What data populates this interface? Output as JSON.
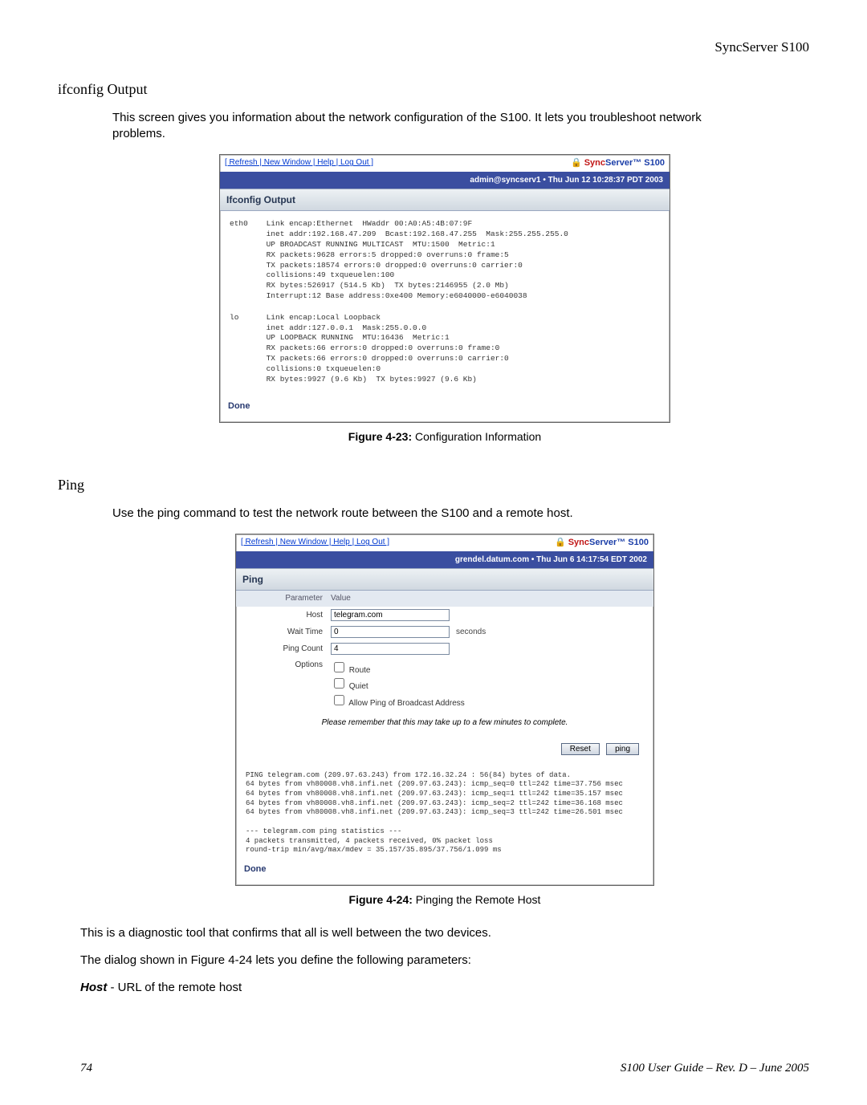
{
  "header_right": "SyncServer S100",
  "section1": {
    "title": "ifconfig Output",
    "intro": "This screen gives you information about the network configuration of the S100. It lets you troubleshoot network problems."
  },
  "fig1": {
    "toolbar_links": "[ Refresh | New Window | Help | Log Out ]",
    "brand_prefix": "Sync",
    "brand_suffix": "Server™ S100",
    "userbar": "admin@syncserv1 • Thu Jun 12 10:28:37 PDT 2003",
    "panel_title": "Ifconfig Output",
    "eth0": "eth0    Link encap:Ethernet  HWaddr 00:A0:A5:4B:07:9F\n        inet addr:192.168.47.209  Bcast:192.168.47.255  Mask:255.255.255.0\n        UP BROADCAST RUNNING MULTICAST  MTU:1500  Metric:1\n        RX packets:9628 errors:5 dropped:0 overruns:0 frame:5\n        TX packets:18574 errors:0 dropped:0 overruns:0 carrier:0\n        collisions:49 txqueuelen:100\n        RX bytes:526917 (514.5 Kb)  TX bytes:2146955 (2.0 Mb)\n        Interrupt:12 Base address:0xe400 Memory:e6040000-e6040038",
    "lo": "lo      Link encap:Local Loopback\n        inet addr:127.0.0.1  Mask:255.0.0.0\n        UP LOOPBACK RUNNING  MTU:16436  Metric:1\n        RX packets:66 errors:0 dropped:0 overruns:0 frame:0\n        TX packets:66 errors:0 dropped:0 overruns:0 carrier:0\n        collisions:0 txqueuelen:0\n        RX bytes:9927 (9.6 Kb)  TX bytes:9927 (9.6 Kb)",
    "done": "Done",
    "caption_b": "Figure 4-23:",
    "caption_t": "  Configuration Information"
  },
  "section2": {
    "title": "Ping",
    "intro": "Use the ping command to test the network route between the S100 and a remote host."
  },
  "fig2": {
    "toolbar_links": "[ Refresh | New Window | Help | Log Out ]",
    "brand_prefix": "Sync",
    "brand_suffix": "Server™ S100",
    "userbar": "grendel.datum.com • Thu Jun 6 14:17:54 EDT 2002",
    "panel_title": "Ping",
    "param_hdr_l": "Parameter",
    "param_hdr_r": "Value",
    "host_label": "Host",
    "host_value": "telegram.com",
    "wait_label": "Wait Time",
    "wait_value": "0",
    "wait_hint": "seconds",
    "count_label": "Ping Count",
    "count_value": "4",
    "options_label": "Options",
    "opt_route": "Route",
    "opt_quiet": "Quiet",
    "opt_bcast": "Allow Ping of Broadcast Address",
    "note": "Please remember that this may take up to a few minutes to complete.",
    "btn_reset": "Reset",
    "btn_ping": "ping",
    "output": "PING telegram.com (209.97.63.243) from 172.16.32.24 : 56(84) bytes of data.\n64 bytes from vh80008.vh8.infi.net (209.97.63.243): icmp_seq=0 ttl=242 time=37.756 msec\n64 bytes from vh80008.vh8.infi.net (209.97.63.243): icmp_seq=1 ttl=242 time=35.157 msec\n64 bytes from vh80008.vh8.infi.net (209.97.63.243): icmp_seq=2 ttl=242 time=36.168 msec\n64 bytes from vh80008.vh8.infi.net (209.97.63.243): icmp_seq=3 ttl=242 time=26.501 msec\n\n--- telegram.com ping statistics ---\n4 packets transmitted, 4 packets received, 0% packet loss\nround-trip min/avg/max/mdev = 35.157/35.895/37.756/1.099 ms",
    "done": "Done",
    "caption_b": "Figure 4-24:",
    "caption_t": "  Pinging the Remote Host"
  },
  "para1": "This is a diagnostic tool that confirms that all is well between the two devices.",
  "para2": "The dialog shown in Figure 4-24 lets you define the following parameters:",
  "para3_b": "Host",
  "para3_t": " - URL of the remote host",
  "footer": {
    "page": "74",
    "doc": "S100 User Guide – Rev. D – June 2005"
  }
}
